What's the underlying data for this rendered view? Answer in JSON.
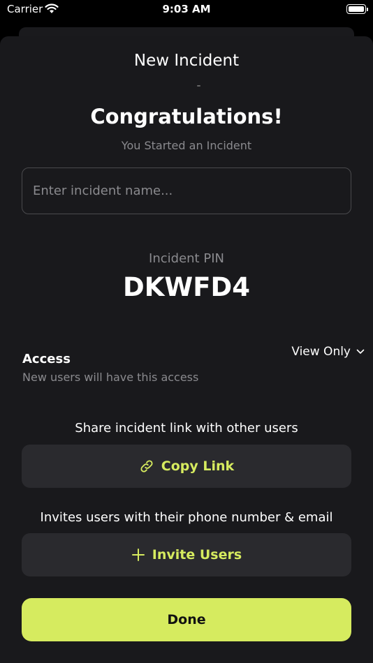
{
  "status_bar": {
    "carrier": "Carrier",
    "time": "9:03 AM"
  },
  "sheet": {
    "title": "New Incident"
  },
  "header": {
    "heading": "Congratulations!",
    "subtitle": "You Started an Incident"
  },
  "incident_name": {
    "placeholder": "Enter incident name...",
    "value": ""
  },
  "pin": {
    "label": "Incident PIN",
    "value": "DKWFD4"
  },
  "access": {
    "title": "Access",
    "subtitle": "New users will have this access",
    "selected": "View Only"
  },
  "share": {
    "label": "Share incident link with other users",
    "button_label": "Copy Link",
    "icon": "link-icon"
  },
  "invite": {
    "label": "Invites users with their phone number & email",
    "button_label": "Invite Users",
    "icon": "plus-icon"
  },
  "done": {
    "label": "Done"
  },
  "colors": {
    "accent": "#d6eb5f",
    "background": "#19191c",
    "button_bg": "#2a2a2e",
    "muted_text": "#8a8a8e"
  }
}
